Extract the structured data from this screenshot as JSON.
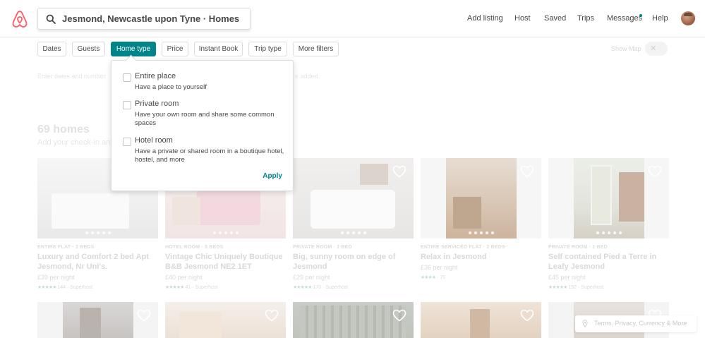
{
  "header": {
    "search_text": "Jesmond, Newcastle upon Tyne · Homes",
    "nav": [
      "Add listing",
      "Host",
      "Saved",
      "Trips",
      "Messages",
      "Help"
    ]
  },
  "filters": {
    "items": [
      "Dates",
      "Guests",
      "Home type",
      "Price",
      "Instant Book",
      "Trip type",
      "More filters"
    ],
    "active": "Home type",
    "show_map_label": "Show Map"
  },
  "hint_text": [
    "Enter dates and number",
    "e added."
  ],
  "results": {
    "count_label": "69 homes",
    "checkin_hint": "Add your check-in and"
  },
  "home_type_popup": {
    "options": [
      {
        "label": "Entire place",
        "description": "Have a place to yourself"
      },
      {
        "label": "Private room",
        "description": "Have your own room and share some common spaces"
      },
      {
        "label": "Hotel room",
        "description": "Have a private or shared room in a boutique hotel, hostel, and more"
      }
    ],
    "apply_label": "Apply"
  },
  "listings": [
    {
      "kind": "ENTIRE FLAT · 2 BEDS",
      "title": "Luxury and Comfort 2 bed Apt Jesmond, Nr Uni's.",
      "price": "£39 per night",
      "stars": "★★★★★",
      "reviews": "144 · Superhost"
    },
    {
      "kind": "HOTEL ROOM · 5 BEDS",
      "title": "Vintage Chic Uniquely Boutique B&B Jesmond NE2 1ET",
      "price": "£40 per night",
      "stars": "★★★★★",
      "reviews": "41 · Superhost"
    },
    {
      "kind": "PRIVATE ROOM · 1 BED",
      "title": "Big, sunny room on edge of Jesmond",
      "price": "£29 per night",
      "stars": "★★★★★",
      "reviews": "170 · Superhost"
    },
    {
      "kind": "ENTIRE SERVICED FLAT · 2 BEDS",
      "title": "Relax in Jesmond",
      "price": "£36 per night",
      "stars": "★★★★",
      "reviews": "· 75"
    },
    {
      "kind": "PRIVATE ROOM · 1 BED",
      "title": "Self contained Pied a Terre in Leafy Jesmond",
      "price": "£45 per night",
      "stars": "★★★★★",
      "reviews": "192 · Superhost"
    }
  ],
  "footer": {
    "terms_label": "Terms, Privacy, Currency & More"
  },
  "colors": {
    "accent": "#008489",
    "brand": "#FF5A5F"
  },
  "icons": [
    "airbnb-logo-icon",
    "search-icon",
    "heart-icon",
    "close-icon",
    "location-pin-icon"
  ]
}
